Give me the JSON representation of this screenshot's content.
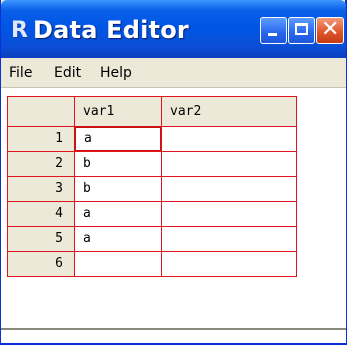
{
  "window": {
    "title": "Data Editor",
    "app_icon": "R"
  },
  "titlebar_buttons": {
    "minimize_icon": "minimize-icon",
    "maximize_icon": "maximize-icon",
    "close_glyph": "✕"
  },
  "menu": [
    "File",
    "Edit",
    "Help"
  ],
  "grid": {
    "columns": [
      "var1",
      "var2"
    ],
    "rows": [
      {
        "num": "1",
        "var1": "a",
        "var2": ""
      },
      {
        "num": "2",
        "var1": "b",
        "var2": ""
      },
      {
        "num": "3",
        "var1": "b",
        "var2": ""
      },
      {
        "num": "4",
        "var1": "a",
        "var2": ""
      },
      {
        "num": "5",
        "var1": "a",
        "var2": ""
      },
      {
        "num": "6",
        "var1": "",
        "var2": ""
      }
    ],
    "selected": {
      "row": "1",
      "column": "var1"
    }
  },
  "colors": {
    "grid_line": "#e0141e",
    "titlebar": "#0055e5",
    "header_bg": "#ece9d8"
  }
}
